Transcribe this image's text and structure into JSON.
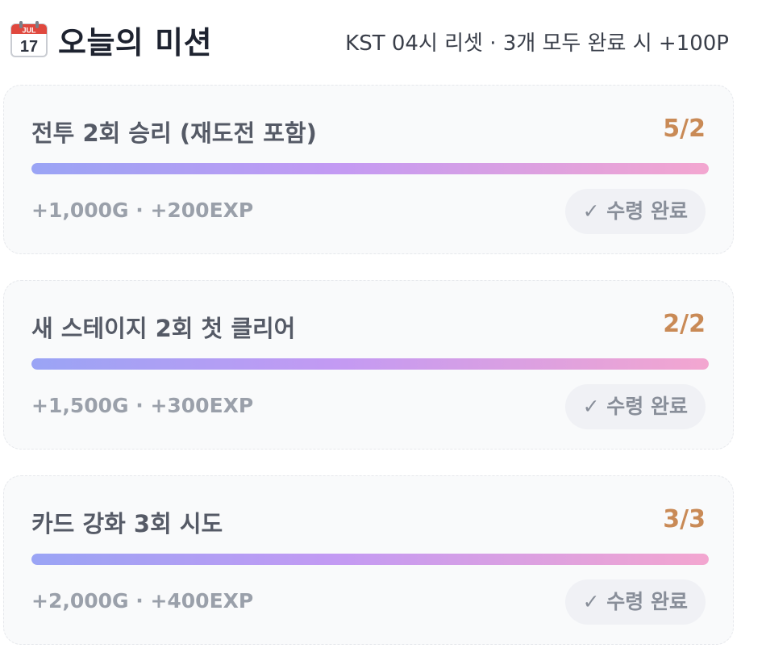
{
  "header": {
    "icon": "calendar-icon",
    "calendar_month": "JUL",
    "calendar_day": "17",
    "title": "오늘의 미션",
    "reset_info": "KST 04시 리셋 · 3개 모두 완료 시 +100P"
  },
  "colors": {
    "accent_count": "#c98a56",
    "bar_start": "#9aa4f5",
    "bar_mid": "#c39af3",
    "bar_end": "#f3a6d0",
    "card_bg": "#f9fafb"
  },
  "missions": [
    {
      "name": "전투 2회 승리 (재도전 포함)",
      "count": "5/2",
      "progress": 1.0,
      "reward": "+1,000G · +200EXP",
      "status": "✓ 수령 완료"
    },
    {
      "name": "새 스테이지 2회 첫 클리어",
      "count": "2/2",
      "progress": 1.0,
      "reward": "+1,500G · +300EXP",
      "status": "✓ 수령 완료"
    },
    {
      "name": "카드 강화 3회 시도",
      "count": "3/3",
      "progress": 1.0,
      "reward": "+2,000G · +400EXP",
      "status": "✓ 수령 완료"
    }
  ]
}
